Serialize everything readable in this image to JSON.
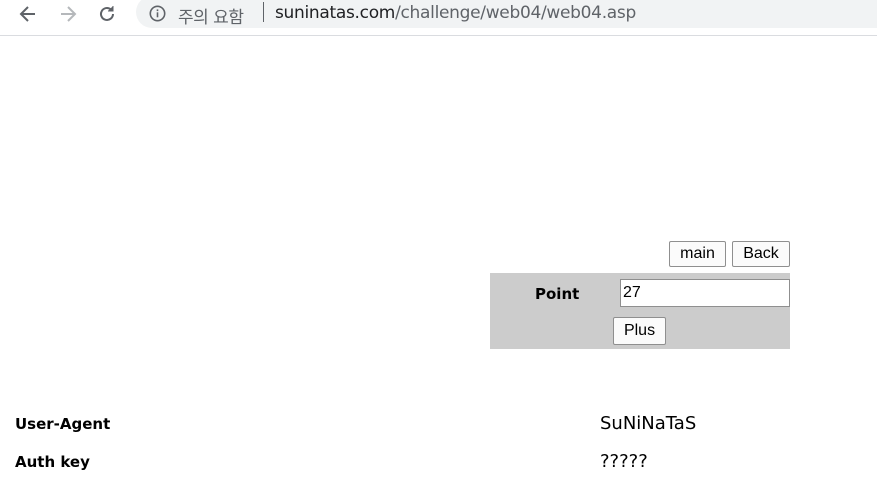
{
  "browser": {
    "security_warning": "주의 요함",
    "url_host": "suninatas.com",
    "url_path": "/challenge/web04/web04.asp",
    "icons": [
      "back-arrow-icon",
      "forward-arrow-icon",
      "reload-icon",
      "info-icon"
    ]
  },
  "page": {
    "nav_buttons": {
      "main": "main",
      "back": "Back"
    },
    "point_form": {
      "label": "Point",
      "value": "27",
      "submit_label": "Plus"
    },
    "info_rows": [
      {
        "label": "User-Agent",
        "value": "SuNiNaTaS"
      },
      {
        "label": "Auth key",
        "value": "?????"
      }
    ],
    "colors": {
      "panel_bg": "#cccccc"
    }
  }
}
